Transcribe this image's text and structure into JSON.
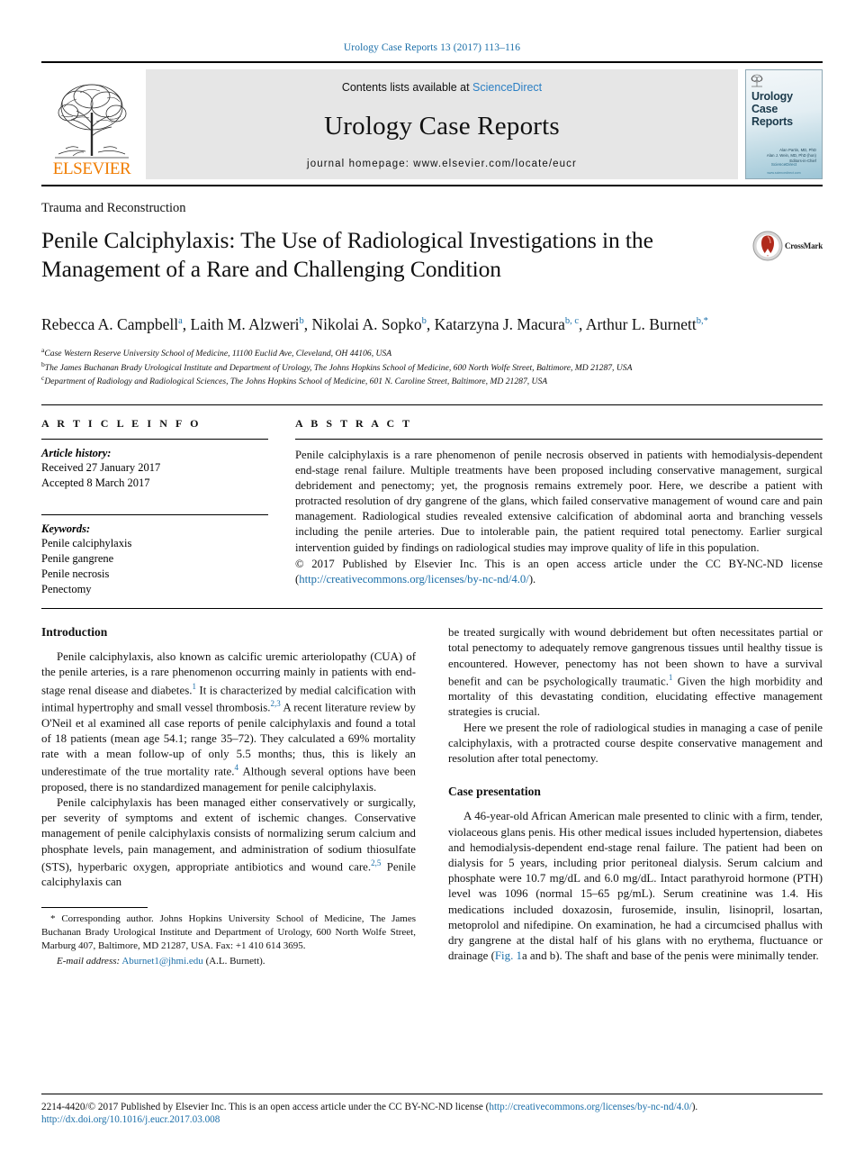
{
  "running_head": "Urology Case Reports 13 (2017) 113–116",
  "masthead": {
    "publisher": "ELSEVIER",
    "contents_prefix": "Contents lists available at ",
    "contents_link": "ScienceDirect",
    "journal_title": "Urology Case Reports",
    "homepage": "journal homepage: www.elsevier.com/locate/eucr",
    "cover": {
      "brand": "ELSEVIER",
      "title_line1": "Urology",
      "title_line2": "Case",
      "title_line3": "Reports",
      "editor1": "Alan Partin, MD, PhD",
      "editor2": "Alan J. Wein, MD, PhD (hon)",
      "editor_role": "Editors-in-Chief",
      "sciencedirect": "ScienceDirect",
      "url": "www.sciencedirect.com"
    }
  },
  "article": {
    "kicker": "Trauma and Reconstruction",
    "title": "Penile Calciphylaxis: The Use of Radiological Investigations in the Management of a Rare and Challenging Condition",
    "crossmark_label": "CrossMark",
    "authors_html": "Rebecca A. Campbell<sup>a</sup>, Laith M. Alzweri<sup>b</sup>, Nikolai A. Sopko<sup>b</sup>, Katarzyna J. Macura<sup>b, c</sup>, Arthur L. Burnett<sup>b,*</sup>",
    "affiliations": [
      {
        "marker": "a",
        "text": "Case Western Reserve University School of Medicine, 11100 Euclid Ave, Cleveland, OH 44106, USA"
      },
      {
        "marker": "b",
        "text": "The James Buchanan Brady Urological Institute and Department of Urology, The Johns Hopkins School of Medicine, 600 North Wolfe Street, Baltimore, MD 21287, USA"
      },
      {
        "marker": "c",
        "text": "Department of Radiology and Radiological Sciences, The Johns Hopkins School of Medicine, 601 N. Caroline Street, Baltimore, MD 21287, USA"
      }
    ]
  },
  "article_info": {
    "heading": "A R T I C L E   I N F O",
    "history_label": "Article history:",
    "received": "Received 27 January 2017",
    "accepted": "Accepted 8 March 2017",
    "keywords_label": "Keywords:",
    "keywords": [
      "Penile calciphylaxis",
      "Penile gangrene",
      "Penile necrosis",
      "Penectomy"
    ]
  },
  "abstract": {
    "heading": "A B S T R A C T",
    "text": "Penile calciphylaxis is a rare phenomenon of penile necrosis observed in patients with hemodialysis-dependent end-stage renal failure. Multiple treatments have been proposed including conservative management, surgical debridement and penectomy; yet, the prognosis remains extremely poor. Here, we describe a patient with protracted resolution of dry gangrene of the glans, which failed conservative management of wound care and pain management. Radiological studies revealed extensive calcification of abdominal aorta and branching vessels including the penile arteries. Due to intolerable pain, the patient required total penectomy. Earlier surgical intervention guided by findings on radiological studies may improve quality of life in this population.",
    "copyright_prefix": "© 2017 Published by Elsevier Inc. This is an open access article under the CC BY-NC-ND license (",
    "copyright_link": "http://creativecommons.org/licenses/by-nc-nd/4.0/",
    "copyright_suffix": ")."
  },
  "body": {
    "left": {
      "intro_heading": "Introduction",
      "p1_a": "Penile calciphylaxis, also known as calcific uremic arteriolopathy (CUA) of the penile arteries, is a rare phenomenon occurring mainly in patients with end-stage renal disease and diabetes.",
      "p1_ref1": "1",
      "p1_b": " It is characterized by medial calcification with intimal hypertrophy and small vessel thrombosis.",
      "p1_ref2": "2,3",
      "p1_c": " A recent literature review by O'Neil et al examined all case reports of penile calciphylaxis and found a total of 18 patients (mean age 54.1; range 35–72). They calculated a 69% mortality rate with a mean follow-up of only 5.5 months; thus, this is likely an underestimate of the true mortality rate.",
      "p1_ref3": "4",
      "p1_d": " Although several options have been proposed, there is no standardized management for penile calciphylaxis.",
      "p2_a": "Penile calciphylaxis has been managed either conservatively or surgically, per severity of symptoms and extent of ischemic changes. Conservative management of penile calciphylaxis consists of normalizing serum calcium and phosphate levels, pain management, and administration of sodium thiosulfate (STS), hyperbaric oxygen, appropriate antibiotics and wound care.",
      "p2_ref": "2,5",
      "p2_b": " Penile calciphylaxis can"
    },
    "right": {
      "p_cont": "be treated surgically with wound debridement but often necessitates partial or total penectomy to adequately remove gangrenous tissues until healthy tissue is encountered. However, penectomy has not been shown to have a survival benefit and can be psychologically traumatic.",
      "p_cont_ref": "1",
      "p_cont_b": " Given the high morbidity and mortality of this devastating condition, elucidating effective management strategies is crucial.",
      "p_here": "Here we present the role of radiological studies in managing a case of penile calciphylaxis, with a protracted course despite conservative management and resolution after total penectomy.",
      "case_heading": "Case presentation",
      "case_a": "A 46-year-old African American male presented to clinic with a firm, tender, violaceous glans penis. His other medical issues included hypertension, diabetes and hemodialysis-dependent end-stage renal failure. The patient had been on dialysis for 5 years, including prior peritoneal dialysis. Serum calcium and phosphate were 10.7 mg/dL and 6.0 mg/dL. Intact parathyroid hormone (PTH) level was 1096 (normal 15–65 pg/mL). Serum creatinine was 1.4. His medications included doxazosin, furosemide, insulin, lisinopril, losartan, metoprolol and nifedipine. On examination, he had a circumcised phallus with dry gangrene at the distal half of his glans with no erythema, fluctuance or drainage (",
      "case_figlink": "Fig. 1",
      "case_b": "a and b). The shaft and base of the penis were minimally tender."
    }
  },
  "corresponding": {
    "text": "* Corresponding author. Johns Hopkins University School of Medicine, The James Buchanan Brady Urological Institute and Department of Urology, 600 North Wolfe Street, Marburg 407, Baltimore, MD 21287, USA. Fax: +1 410 614 3695.",
    "email_label": "E-mail address:",
    "email": "Aburnet1@jhmi.edu",
    "email_owner": "(A.L. Burnett)."
  },
  "footer": {
    "issn_copyright_prefix": "2214-4420/© 2017 Published by Elsevier Inc. This is an open access article under the CC BY-NC-ND license (",
    "license_link": "http://creativecommons.org/licenses/by-nc-nd/4.0/",
    "issn_copyright_suffix": ").",
    "doi": "http://dx.doi.org/10.1016/j.eucr.2017.03.008"
  },
  "colors": {
    "link": "#1a6ea8",
    "elsevier_orange": "#f07c00",
    "masthead_grey": "#e6e6e6"
  }
}
